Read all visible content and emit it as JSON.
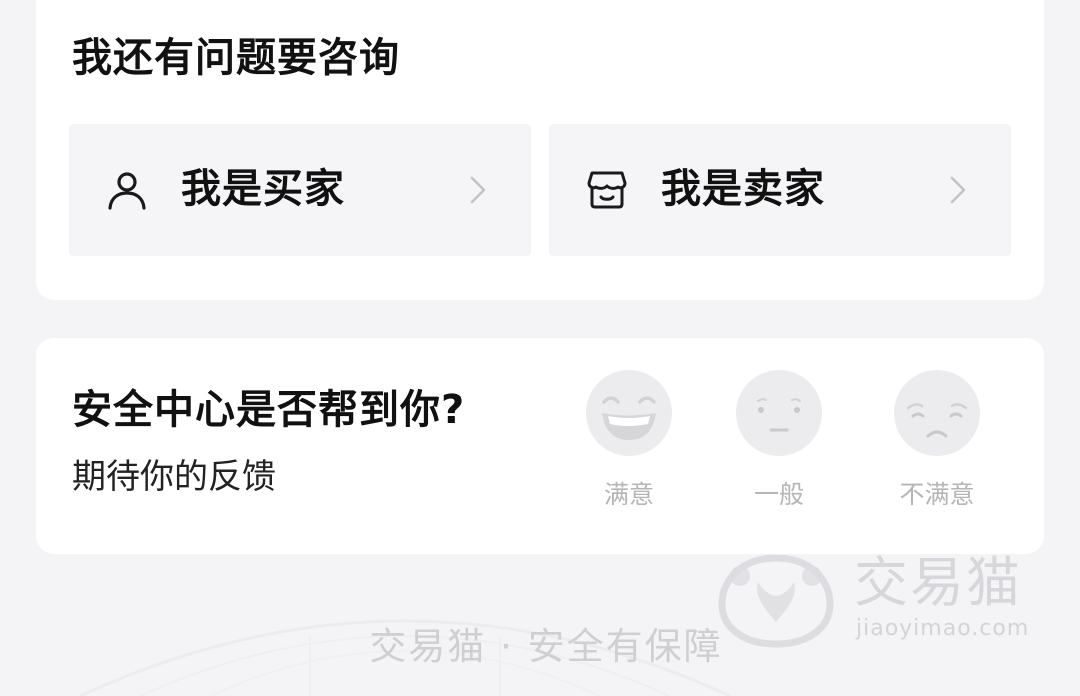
{
  "consult": {
    "title": "我还有问题要咨询",
    "buyer": {
      "label": "我是买家",
      "icon": "user-icon"
    },
    "seller": {
      "label": "我是卖家",
      "icon": "shop-icon"
    }
  },
  "feedback": {
    "title": "安全中心是否帮到你?",
    "subtitle": "期待你的反馈",
    "options": [
      {
        "label": "满意",
        "icon": "laughing-face-icon"
      },
      {
        "label": "一般",
        "icon": "neutral-face-icon"
      },
      {
        "label": "不满意",
        "icon": "sad-face-icon"
      }
    ]
  },
  "footer": {
    "text": "交易猫 · 安全有保障"
  },
  "watermark": {
    "brand": "交易猫",
    "domain": "jiaoyimao.com"
  },
  "colors": {
    "background": "#f4f4f6",
    "card": "#ffffff",
    "tile": "#f5f5f8",
    "muted_text": "#b5b5b8",
    "face": "#ececee"
  }
}
